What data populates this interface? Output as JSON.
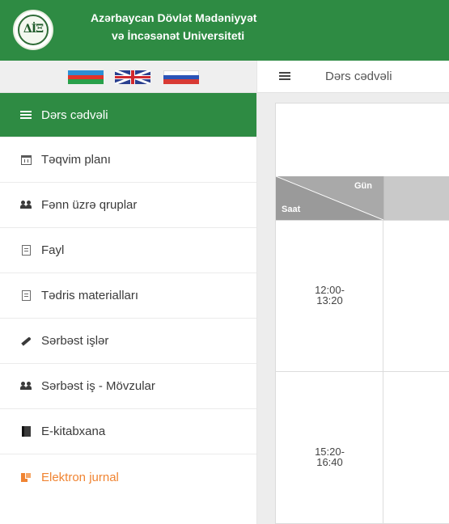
{
  "header": {
    "title_line1": "Azərbaycan Dövlət Mədəniyyət",
    "title_line2": "və İncəsənət Universiteti",
    "logo_text": "ΔİΞ",
    "bg_color": "#2e8b43"
  },
  "languages": [
    {
      "name": "az-flag-icon"
    },
    {
      "name": "uk-flag-icon"
    },
    {
      "name": "ru-flag-icon"
    }
  ],
  "sidebar": {
    "items": [
      {
        "label": "Dərs cədvəli",
        "icon": "list-icon",
        "active": true
      },
      {
        "label": "Təqvim planı",
        "icon": "calendar-icon"
      },
      {
        "label": "Fənn üzrə qruplar",
        "icon": "users-icon"
      },
      {
        "label": "Fayl",
        "icon": "file-icon"
      },
      {
        "label": "Tədris materialları",
        "icon": "file-icon"
      },
      {
        "label": "Sərbəst işlər",
        "icon": "pencil-icon"
      },
      {
        "label": "Sərbəst iş - Mövzular",
        "icon": "users-icon"
      },
      {
        "label": "E-kitabxana",
        "icon": "book-icon"
      },
      {
        "label": "Elektron jurnal",
        "icon": "journal-icon",
        "color": "#f08432"
      }
    ]
  },
  "toolbar": {
    "breadcrumb": "Dərs cədvəli"
  },
  "schedule": {
    "header_day": "Gün",
    "header_time": "Saat",
    "rows": [
      {
        "start": "12:00-",
        "end": "13:20"
      },
      {
        "start": "15:20-",
        "end": "16:40"
      }
    ]
  }
}
